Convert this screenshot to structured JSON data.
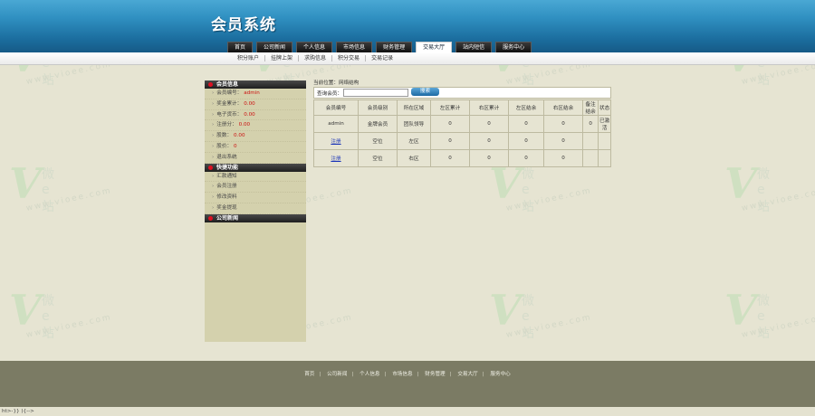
{
  "header": {
    "title": "会员系统"
  },
  "nav": [
    "首页",
    "公司新闻",
    "个人信息",
    "市场信息",
    "财务管理",
    "交易大厅",
    "站内短信",
    "服务中心"
  ],
  "nav_active": 5,
  "subnav": [
    "积分账户",
    "挂牌上架",
    "求购信息",
    "积分交易",
    "交易记录"
  ],
  "sidebar": {
    "member_header": "会员信息",
    "member_rows": [
      {
        "label": "会员编号：",
        "value": "admin"
      },
      {
        "label": "奖金累计：",
        "value": "0.00"
      },
      {
        "label": "电子货币：",
        "value": "0.00"
      },
      {
        "label": "注册分：",
        "value": "0.00"
      },
      {
        "label": "股数：",
        "value": "0.00"
      },
      {
        "label": "股价：",
        "value": "0"
      },
      {
        "label": "退出系统",
        "value": ""
      }
    ],
    "quick_header": "快捷功能",
    "quick_rows": [
      "汇款通知",
      "会员注册",
      "修改资料",
      "奖金提现"
    ],
    "notice_header": "公司新闻"
  },
  "main": {
    "breadcrumb": "当前位置：网络结构",
    "search_label": "查询会员：",
    "search_value": "",
    "search_button": "搜索",
    "table": {
      "headers": [
        "会员编号",
        "会员级别",
        "所在区域",
        "左区累计",
        "右区累计",
        "左区结余",
        "右区结余",
        "备注结余",
        "状态"
      ],
      "rows": [
        [
          "admin",
          "金牌会员",
          "团队领导",
          "0",
          "0",
          "0",
          "0",
          "0",
          "已激活"
        ],
        [
          "注册",
          "空位",
          "左区",
          "0",
          "0",
          "0",
          "0",
          "",
          ""
        ],
        [
          "注册",
          "空位",
          "右区",
          "0",
          "0",
          "0",
          "0",
          "",
          ""
        ]
      ]
    }
  },
  "footer": {
    "links": [
      "首页",
      "公司新闻",
      "个人信息",
      "市场信息",
      "财务管理",
      "交易大厅",
      "服务中心"
    ],
    "status": "ht>-}} ){-->"
  },
  "watermark": {
    "text": "微 e 站",
    "url": "www.vioee.com"
  }
}
